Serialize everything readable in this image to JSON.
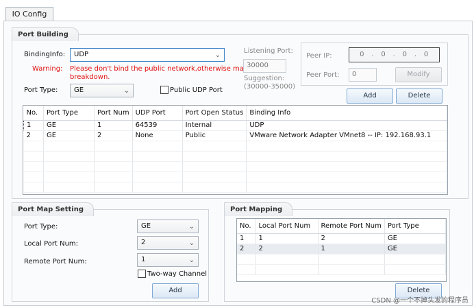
{
  "tab": {
    "label": "IO Config"
  },
  "port_building": {
    "title": "Port Building",
    "binding_info_label": "BindingInfo:",
    "binding_info_value": "UDP",
    "warning_label": "Warning:",
    "warning_text_1": "Please don't bind the public network,otherwise maybe",
    "warning_text_2": "breakdown.",
    "port_type_label": "Port Type:",
    "port_type_value": "GE",
    "public_udp_label": "Public UDP Port",
    "listening_port_label": "Listening Port:",
    "listening_port_value": "30000",
    "suggestion_label": "Suggestion:",
    "suggestion_range": "(30000-35000)",
    "peer_ip_label": "Peer IP:",
    "peer_ip_octets": [
      "0",
      "0",
      "0",
      "0"
    ],
    "peer_ip_dots": [
      ".",
      ".",
      "."
    ],
    "peer_port_label": "Peer Port:",
    "peer_port_value": "0",
    "modify_label": "Modify",
    "add_label": "Add",
    "delete_label": "Delete",
    "table": {
      "headers": [
        "No.",
        "Port Type",
        "Port Num",
        "UDP Port",
        "Port Open Status",
        "Binding Info"
      ],
      "rows": [
        [
          "1",
          "GE",
          "1",
          "64539",
          "Internal",
          "UDP"
        ],
        [
          "2",
          "GE",
          "2",
          "None",
          "Public",
          "VMware Network Adapter VMnet8 -- IP: 192.168.93.1"
        ]
      ]
    }
  },
  "port_map_setting": {
    "title": "Port Map Setting",
    "port_type_label": "Port Type:",
    "port_type_value": "GE",
    "local_port_label": "Local Port Num:",
    "local_port_value": "2",
    "remote_port_label": "Remote Port Num:",
    "remote_port_value": "1",
    "two_way_label": "Two-way Channel",
    "add_label": "Add"
  },
  "port_mapping": {
    "title": "Port Mapping",
    "table": {
      "headers": [
        "No.",
        "Local Port Num",
        "Remote Port Num",
        "Port Type"
      ],
      "rows": [
        [
          "1",
          "1",
          "2",
          "GE"
        ],
        [
          "2",
          "2",
          "1",
          "GE"
        ]
      ]
    },
    "delete_label": "Delete"
  },
  "watermark": "CSDN @一个不掉头发的程序员",
  "icons": {
    "dropdown": "chevron-down-icon"
  }
}
